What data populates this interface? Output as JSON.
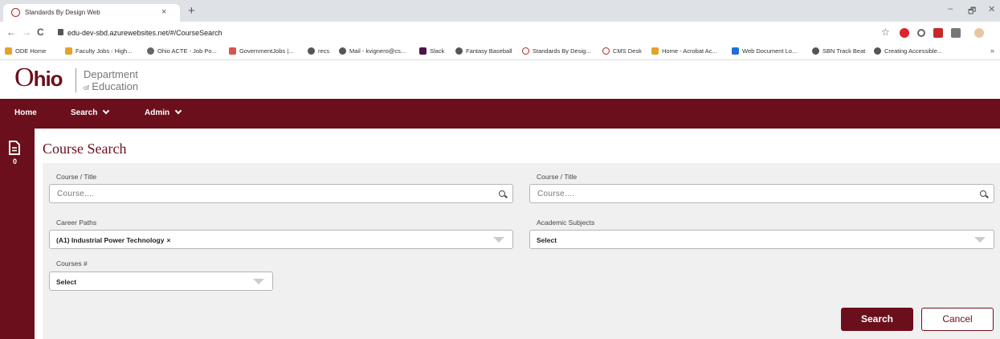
{
  "browser": {
    "tab_title": "Standards By Design Web",
    "tab_close": "×",
    "new_tab": "+",
    "url": "edu-dev-sbd.azurewebsites.net/#/CourseSearch",
    "minimize": "–",
    "maximize": "🗗",
    "close": "✕",
    "back": "←",
    "forward": "→",
    "reload": "C",
    "star": "☆",
    "bookmarks_more": "»",
    "bookmarks": [
      {
        "label": "ODE Home",
        "color": "#e2a32a"
      },
      {
        "label": "Faculty Jobs - High...",
        "color": "#e2a32a"
      },
      {
        "label": "Ohio ACTE - Job Po...",
        "color": "#666666"
      },
      {
        "label": "GovernmentJobs |...",
        "color": "#d9534f"
      },
      {
        "label": "recs",
        "color": "#555555"
      },
      {
        "label": "Mail - kvignero@cs...",
        "color": "#555555"
      },
      {
        "label": "Slack",
        "color": "#4a154b"
      },
      {
        "label": "Fantasy Baseball",
        "color": "#555555"
      },
      {
        "label": "Standards By Desig...",
        "color": "#b22222"
      },
      {
        "label": "CMS Desk",
        "color": "#b22222"
      },
      {
        "label": "Home - Acrobat Ac...",
        "color": "#e2a32a"
      },
      {
        "label": "Web Document Lo...",
        "color": "#1e6fd9"
      },
      {
        "label": "SBN Track Beat",
        "color": "#555555"
      },
      {
        "label": "Creating Accessible...",
        "color": "#555555"
      }
    ]
  },
  "header": {
    "logo_o": "O",
    "logo_hio": "hio",
    "dept_line1": "Department",
    "dept_line2_prefix": "of",
    "dept_line2": "Education"
  },
  "nav": {
    "home": "Home",
    "search": "Search",
    "admin": "Admin"
  },
  "sidebar": {
    "doc_count": "0"
  },
  "page": {
    "title": "Course Search"
  },
  "form": {
    "course_title_label_1": "Course / Title",
    "course_title_placeholder_1": "Course....",
    "course_title_label_2": "Course / Title",
    "course_title_placeholder_2": "Course....",
    "career_paths_label": "Career Paths",
    "career_paths_value": "(A1) Industrial Power Technology",
    "career_paths_remove": "×",
    "academic_subjects_label": "Academic Subjects",
    "academic_subjects_value": "Select",
    "courses_num_label": "Courses #",
    "courses_num_value": "Select"
  },
  "buttons": {
    "search": "Search",
    "cancel": "Cancel"
  },
  "colors": {
    "brand": "#6b0f1c",
    "panel": "#f0f0f0"
  }
}
